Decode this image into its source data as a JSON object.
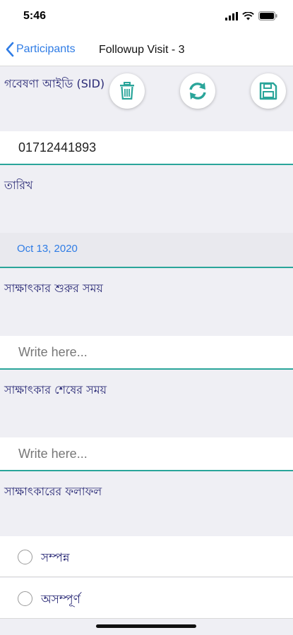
{
  "status": {
    "time": "5:46"
  },
  "nav": {
    "back_label": "Participants",
    "title": "Followup Visit - 3"
  },
  "actions": {
    "delete": "trash-icon",
    "refresh": "refresh-icon",
    "save": "save-icon",
    "color": "#2aa59a"
  },
  "questions": {
    "sid": {
      "label": "গবেষণা আইডি (SID)",
      "value": "01712441893"
    },
    "date": {
      "label": "তারিখ",
      "value": "Oct 13, 2020"
    },
    "start_time": {
      "label": "সাক্ষাৎকার শুরুর সময়",
      "placeholder": "Write here..."
    },
    "end_time": {
      "label": "সাক্ষাৎকার শেষের সময়",
      "placeholder": "Write here..."
    },
    "result": {
      "label": "সাক্ষাৎকারের ফলাফল",
      "options": [
        {
          "label": "সম্পন্ন"
        },
        {
          "label": "অসম্পূর্ণ"
        }
      ]
    }
  },
  "colors": {
    "accent": "#2aa59a",
    "link": "#2f7ce5",
    "label": "#2a2a76"
  }
}
